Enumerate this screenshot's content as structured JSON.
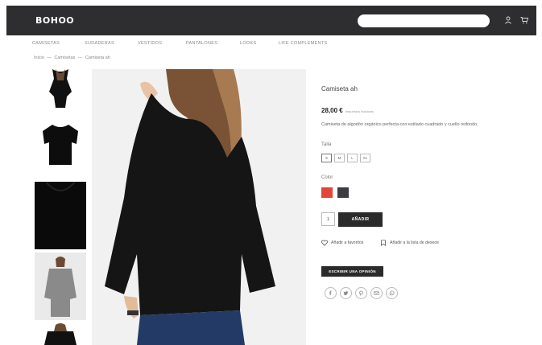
{
  "header": {
    "logo": "BOHOO",
    "search_placeholder": "",
    "account_icon": "user-icon",
    "cart_icon": "cart-icon"
  },
  "nav": {
    "items": [
      {
        "label": "CAMISETAS"
      },
      {
        "label": "SUDADERAS"
      },
      {
        "label": "VESTIDOS"
      },
      {
        "label": "PANTALONES"
      },
      {
        "label": "LOOKS"
      },
      {
        "label": "LIFE COMPLEMENTS"
      }
    ]
  },
  "breadcrumb": {
    "items": [
      "Inicio",
      "Camisetas",
      "Camiseta ah"
    ],
    "separator": "—"
  },
  "product": {
    "title": "Camiseta ah",
    "price": "28,00 €",
    "tax_note": "Impuestos incluidos",
    "description": "Camiseta de algodón orgánico perfecta con estilado cuadrado y cuello redondo.",
    "size_label": "Talla",
    "sizes": [
      "S",
      "M",
      "L",
      "XL"
    ],
    "color_label": "Color",
    "colors": [
      "#e2453a",
      "#3b3d42"
    ],
    "quantity": "1",
    "add_to_cart": "AÑADIR",
    "wishlist": "Añadir a favoritos",
    "compare": "Añadir a la lista de deseos",
    "review": "ESCRIBIR UNA OPINIÓN",
    "share_icons": [
      "facebook-icon",
      "twitter-icon",
      "pinterest-icon",
      "email-icon",
      "whatsapp-icon"
    ]
  },
  "gallery": {
    "thumbnails": [
      "model-back-thumb",
      "flat-front-thumb",
      "fabric-detail-thumb",
      "model-side-thumb",
      "model-front-thumb"
    ],
    "main": "model-back-photo"
  }
}
